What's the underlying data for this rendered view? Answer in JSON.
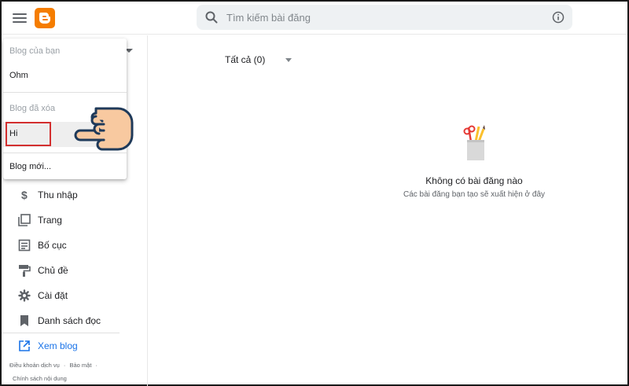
{
  "search": {
    "placeholder": "Tìm kiếm bài đăng"
  },
  "dropdown": {
    "your_blogs_header": "Blog của bạn",
    "your_blogs": [
      "Ohm"
    ],
    "deleted_header": "Blog đã xóa",
    "deleted_blogs": [
      "Hi"
    ],
    "new_blog": "Blog mới..."
  },
  "sidebar": {
    "items": [
      {
        "label": "Thu nhập",
        "icon": "dollar-icon"
      },
      {
        "label": "Trang",
        "icon": "pages-icon"
      },
      {
        "label": "Bố cục",
        "icon": "layout-icon"
      },
      {
        "label": "Chủ đề",
        "icon": "theme-roller-icon"
      },
      {
        "label": "Cài đặt",
        "icon": "gear-icon"
      },
      {
        "label": "Danh sách đọc",
        "icon": "bookmark-icon"
      }
    ],
    "view_blog": "Xem blog",
    "footer": {
      "terms": "Điều khoản dịch vụ",
      "sep": "·",
      "privacy": "Bảo mật",
      "content_policy": "Chính sách nội dung"
    }
  },
  "main": {
    "filter_label": "Tất cả (0)",
    "empty_title": "Không có bài đăng nào",
    "empty_subtitle": "Các bài đăng bạn tạo sẽ xuất hiện ở đây"
  },
  "colors": {
    "brand": "#f57d00",
    "accent": "#1a73e8",
    "highlight_border": "#d32f2f"
  }
}
